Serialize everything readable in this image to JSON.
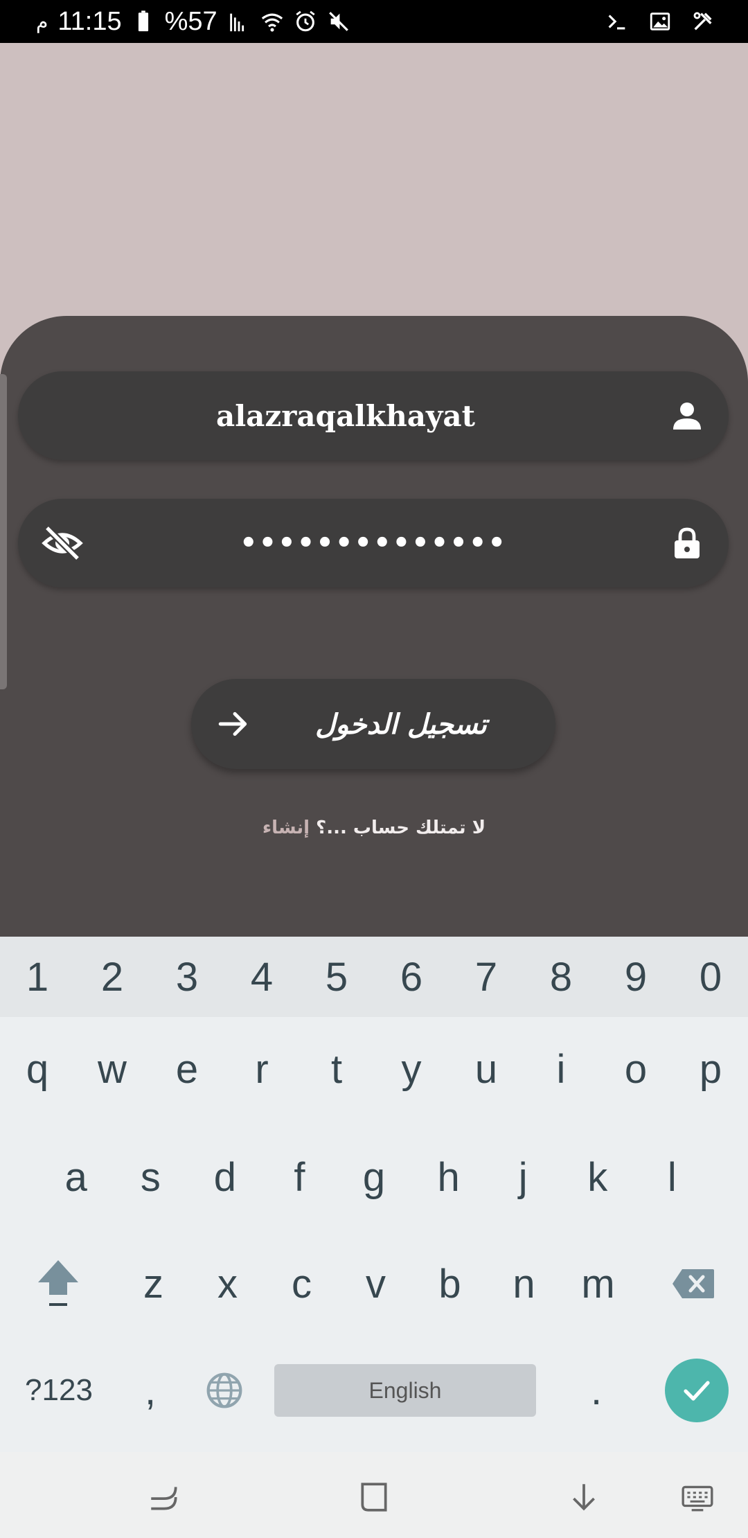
{
  "status_bar": {
    "carrier_label": "م",
    "time": "11:15",
    "battery": "%57"
  },
  "login": {
    "username_value": "alazraqalkhayat",
    "password_value": "••••••••••••••",
    "login_button_label": "تسجيل الدخول",
    "signup_question": "لا تمتلك حساب ...؟",
    "signup_link": "إنشاء"
  },
  "keyboard": {
    "number_row": [
      "1",
      "2",
      "3",
      "4",
      "5",
      "6",
      "7",
      "8",
      "9",
      "0"
    ],
    "row_1": [
      "q",
      "w",
      "e",
      "r",
      "t",
      "y",
      "u",
      "i",
      "o",
      "p"
    ],
    "row_2": [
      "a",
      "s",
      "d",
      "f",
      "g",
      "h",
      "j",
      "k",
      "l"
    ],
    "row_3": [
      "z",
      "x",
      "c",
      "v",
      "b",
      "n",
      "m"
    ],
    "symbols_key": "?123",
    "comma_key": ",",
    "space_label": "English",
    "period_key": "."
  },
  "colors": {
    "background": "#cdbfbf",
    "sheet": "#4f4a4a",
    "field": "#3e3d3d",
    "accent_enter": "#4db6ac"
  }
}
